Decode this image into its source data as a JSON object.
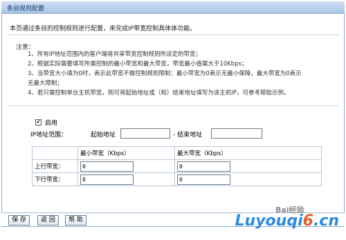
{
  "title": "条目规则配置",
  "intro": "本页通过条目的控制规则进行配置，来完成IP带宽控制具体体功能。",
  "notice_label": "注意：",
  "notes": [
    "1、所有IP地址范围内的客户端将共享带宽控制规则所设定的带宽；",
    "2、根据实际需要填写所需控制的最小带宽和最大带宽，带宽最小值需大于10Kbps；",
    "3、当带宽大小填为0时，表示此带宽不做控制规则限制：最小带宽为0表示无最小保障，最大带宽为0表示",
    "无最大限制；",
    "4、若只需控制单台主机带宽，则可将起始地址或（和）结束地址填写为该主机IP，可参考帮助示例。"
  ],
  "enable": {
    "label": "启用",
    "checked": true,
    "mark": "✔"
  },
  "ip_range": {
    "label": "IP地址范围：",
    "start_label": "起始地址",
    "start_value": "",
    "end_label": "- 结束地址",
    "end_value": ""
  },
  "bandwidth_table": {
    "headers": [
      "",
      "最小带宽（Kbps）",
      "最大带宽（Kbps）"
    ],
    "rows": [
      {
        "label": "上行带宽：",
        "min": "0",
        "max": "0"
      },
      {
        "label": "下行带宽：",
        "min": "0",
        "max": "0"
      }
    ]
  },
  "buttons": {
    "save": "保 存",
    "back": "返 回",
    "help": "帮 助"
  },
  "watermark": {
    "text": "Luyouqi",
    "six": "6",
    "tail": ".cn",
    "baidu": "Bai经验"
  },
  "colors": {
    "titlebar": "#aac6e6",
    "border": "#8aa8cd",
    "watermark": "#2b8be0"
  }
}
